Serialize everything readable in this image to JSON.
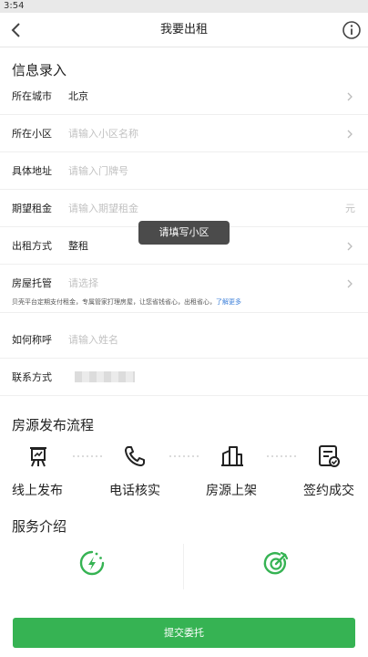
{
  "status": {
    "time": "3:54"
  },
  "nav": {
    "title": "我要出租",
    "back_icon": "chevron-left-icon",
    "info_icon": "info-circle-icon"
  },
  "sections": {
    "info_title": "信息录入",
    "process_title": "房源发布流程",
    "service_title": "服务介绍"
  },
  "form": {
    "city": {
      "label": "所在城市",
      "value": "北京"
    },
    "community": {
      "label": "所在小区",
      "placeholder": "请输入小区名称"
    },
    "address": {
      "label": "具体地址",
      "placeholder": "请输入门牌号"
    },
    "rent": {
      "label": "期望租金",
      "placeholder": "请输入期望租金",
      "unit": "元"
    },
    "rent_type": {
      "label": "出租方式",
      "value": "整租"
    },
    "custody": {
      "label": "房屋托管",
      "placeholder": "请选择",
      "note": "贝壳平台定期支付租金，专属管家打理房屋，让您省钱省心，出租省心，",
      "note_link": "了解更多"
    },
    "name": {
      "label": "如何称呼",
      "placeholder": "请输入姓名"
    },
    "contact": {
      "label": "联系方式"
    }
  },
  "toast": "请填写小区",
  "steps": [
    {
      "label": "线上发布",
      "icon": "easel-icon"
    },
    {
      "label": "电话核实",
      "icon": "phone-icon"
    },
    {
      "label": "房源上架",
      "icon": "buildings-icon"
    },
    {
      "label": "签约成交",
      "icon": "contract-icon"
    }
  ],
  "services": [
    {
      "icon": "lightning-clock-icon"
    },
    {
      "icon": "target-icon"
    }
  ],
  "submit_label": "提交委托",
  "colors": {
    "accent": "#36b353"
  }
}
